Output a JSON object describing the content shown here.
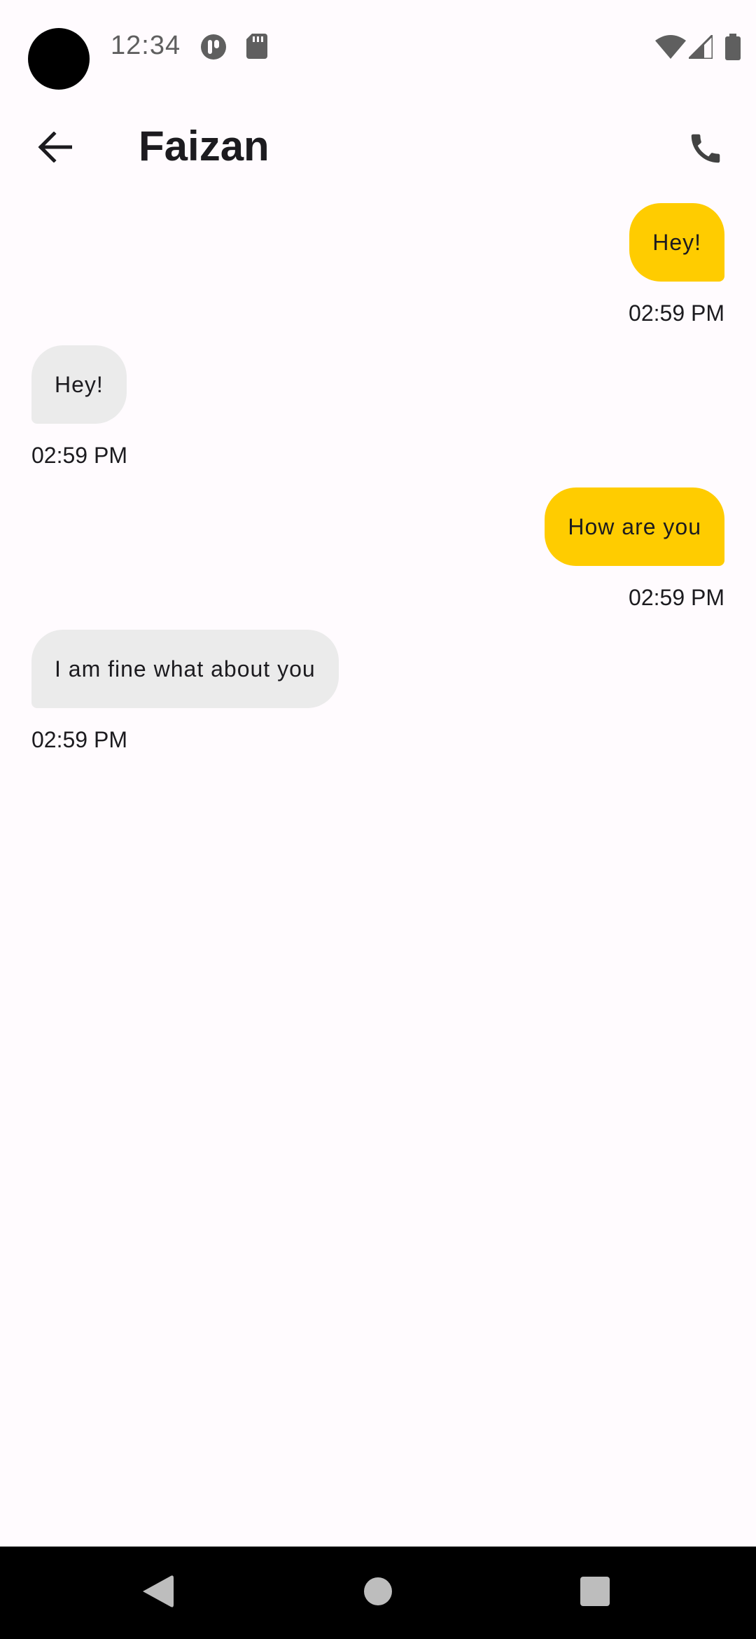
{
  "status_bar": {
    "time": "12:34",
    "icons": [
      "media-icon",
      "sd-card-icon",
      "wifi-icon",
      "cell-signal-icon",
      "battery-icon"
    ]
  },
  "app_bar": {
    "title": "Faizan",
    "back_icon": "arrow-back-icon",
    "call_icon": "phone-icon"
  },
  "messages": [
    {
      "direction": "sent",
      "text": "Hey!",
      "time": "02:59 PM"
    },
    {
      "direction": "received",
      "text": "Hey!",
      "time": "02:59 PM"
    },
    {
      "direction": "sent",
      "text": "How are you",
      "time": "02:59 PM"
    },
    {
      "direction": "received",
      "text": "I am fine what about you",
      "time": "02:59 PM"
    }
  ],
  "colors": {
    "sent_bubble": "#FFCC00",
    "received_bubble": "#EBEBEB",
    "background": "#FFFBFE",
    "nav_bar": "#000000"
  },
  "nav_bar": {
    "icons": [
      "nav-back-icon",
      "nav-home-icon",
      "nav-recents-icon"
    ]
  }
}
